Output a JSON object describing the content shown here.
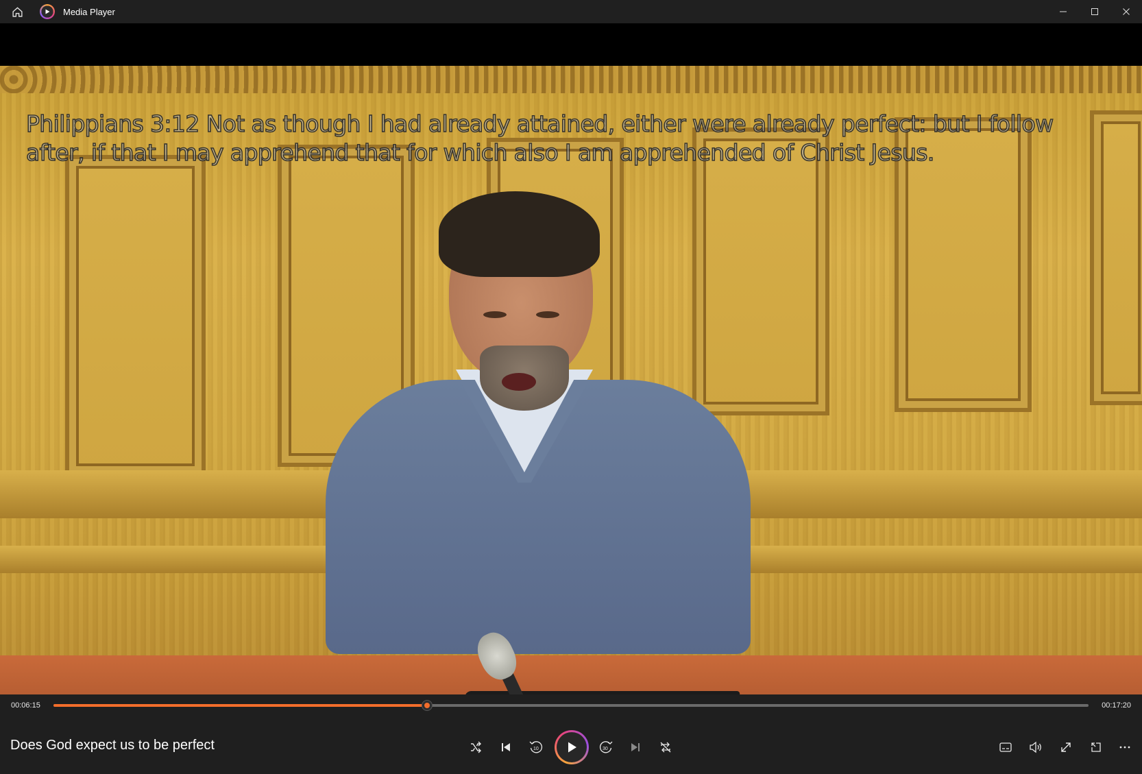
{
  "window": {
    "title": "Media Player"
  },
  "video": {
    "subtitle": "Philippians 3:12  Not as though I had already attained, either were already perfect: but I follow after, if that I may apprehend that for which also I am apprehended of Christ Jesus."
  },
  "playback": {
    "current_time": "00:06:15",
    "total_time": "00:17:20",
    "progress": 0.361,
    "accent_color": "#f26d2b"
  },
  "now_playing": {
    "title": "Does God expect us to be perfect"
  },
  "controls": {
    "center": [
      "shuffle-icon",
      "previous-icon",
      "rewind-10-icon",
      "play-icon",
      "forward-30-icon",
      "next-icon",
      "repeat-off-icon"
    ],
    "right": [
      "subtitles-icon",
      "volume-icon",
      "fullscreen-icon",
      "mini-player-icon",
      "more-icon"
    ],
    "rewind_seconds": "10",
    "forward_seconds": "30"
  }
}
